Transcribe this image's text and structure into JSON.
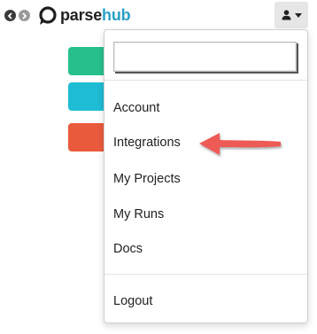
{
  "header": {
    "logo_part1": "parse",
    "logo_part2": "hub",
    "nav_back_icon": "chevron-left-icon",
    "nav_forward_icon": "chevron-right-icon",
    "user_icon": "user-icon",
    "caret_icon": "caret-down-icon"
  },
  "background_buttons": [
    {
      "color": "#27c08d"
    },
    {
      "color": "#1fbcd5"
    },
    {
      "color": "#ea5a3c"
    }
  ],
  "dropdown": {
    "search_value": "",
    "items": {
      "account": "Account",
      "integrations": "Integrations",
      "my_projects": "My Projects",
      "my_runs": "My Runs",
      "docs": "Docs",
      "logout": "Logout"
    }
  },
  "annotation": {
    "arrow_color": "#ee5a55",
    "points_to": "Integrations"
  },
  "colors": {
    "brand_dark": "#1f1f1f",
    "brand_blue": "#2b9fc8",
    "accent": "#2b9fc8"
  }
}
